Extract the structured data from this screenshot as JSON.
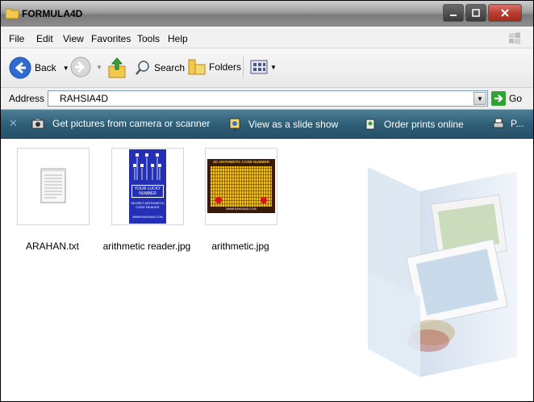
{
  "window": {
    "title": "FORMULA4D"
  },
  "menu": [
    "File",
    "Edit",
    "View",
    "Favorites",
    "Tools",
    "Help"
  ],
  "toolbar": {
    "back": "Back",
    "search": "Search",
    "folders": "Folders"
  },
  "address": {
    "label": "Address",
    "value": "RAHSIA4D",
    "go": "Go"
  },
  "tasks": {
    "camera": "Get pictures from camera or scanner",
    "slideshow": "View as a slide show",
    "prints": "Order prints online",
    "print": "P..."
  },
  "files": [
    {
      "name": "ARAHAN.txt",
      "icon": "text-file-icon"
    },
    {
      "name": "arithmetic reader.jpg",
      "icon": "image-thumbnail",
      "thumb_text": [
        "YOUR LUCKY",
        "NUMBER",
        "SECRET ARITHMETIC",
        "CODE READER",
        "WWW.RAHSIA4D.COM"
      ]
    },
    {
      "name": "arithmetic.jpg",
      "icon": "image-thumbnail",
      "thumb_text": [
        "4D ARITHMETIC CODE NUMBER",
        "WWW.RAHSIA4D.COM"
      ]
    }
  ],
  "colors": {
    "task_bar": "#2e5f78",
    "accent_blue": "#1d4fa8",
    "go_green": "#2fa432"
  }
}
